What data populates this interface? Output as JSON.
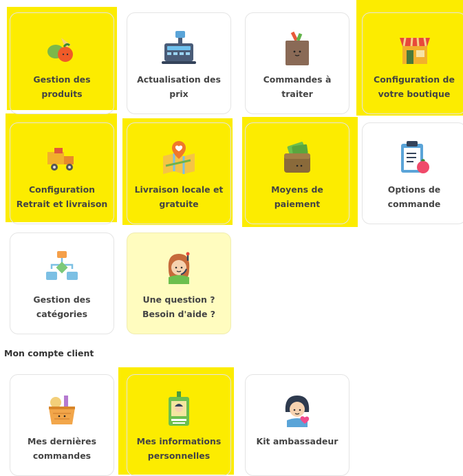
{
  "cards": [
    {
      "line1": "Gestion des",
      "line2": "produits",
      "icon": "fruits-vegetables-icon"
    },
    {
      "line1": "Actualisation des",
      "line2": "prix",
      "icon": "cash-register-icon"
    },
    {
      "line1": "Commandes à",
      "line2": "traiter",
      "icon": "grocery-bag-icon"
    },
    {
      "line1": "Configuration de",
      "line2": "votre boutique",
      "icon": "shop-icon"
    },
    {
      "line1": "Configuration",
      "line2": "Retrait et livraison",
      "icon": "delivery-truck-icon"
    },
    {
      "line1": "Livraison locale et",
      "line2": "gratuite",
      "icon": "map-pin-icon"
    },
    {
      "line1": "Moyens de",
      "line2": "paiement",
      "icon": "wallet-icon"
    },
    {
      "line1": "Options de",
      "line2": "commande",
      "icon": "clipboard-icon"
    },
    {
      "line1": "Gestion des",
      "line2": "catégories",
      "icon": "category-tree-icon"
    },
    {
      "line1": "Une question ?",
      "line2": "Besoin d'aide ?",
      "icon": "support-agent-icon"
    }
  ],
  "account_section": {
    "title": "Mon compte client",
    "cards": [
      {
        "line1": "Mes dernières",
        "line2": "commandes",
        "icon": "basket-icon"
      },
      {
        "line1": "Mes informations",
        "line2": "personnelles",
        "icon": "id-badge-icon"
      },
      {
        "line1": "Kit ambassadeur",
        "line2": "",
        "icon": "ambassador-icon"
      }
    ]
  },
  "colors": {
    "highlight": "#fcec00",
    "help_card": "#fffcbf",
    "border": "#e4e4e4"
  }
}
